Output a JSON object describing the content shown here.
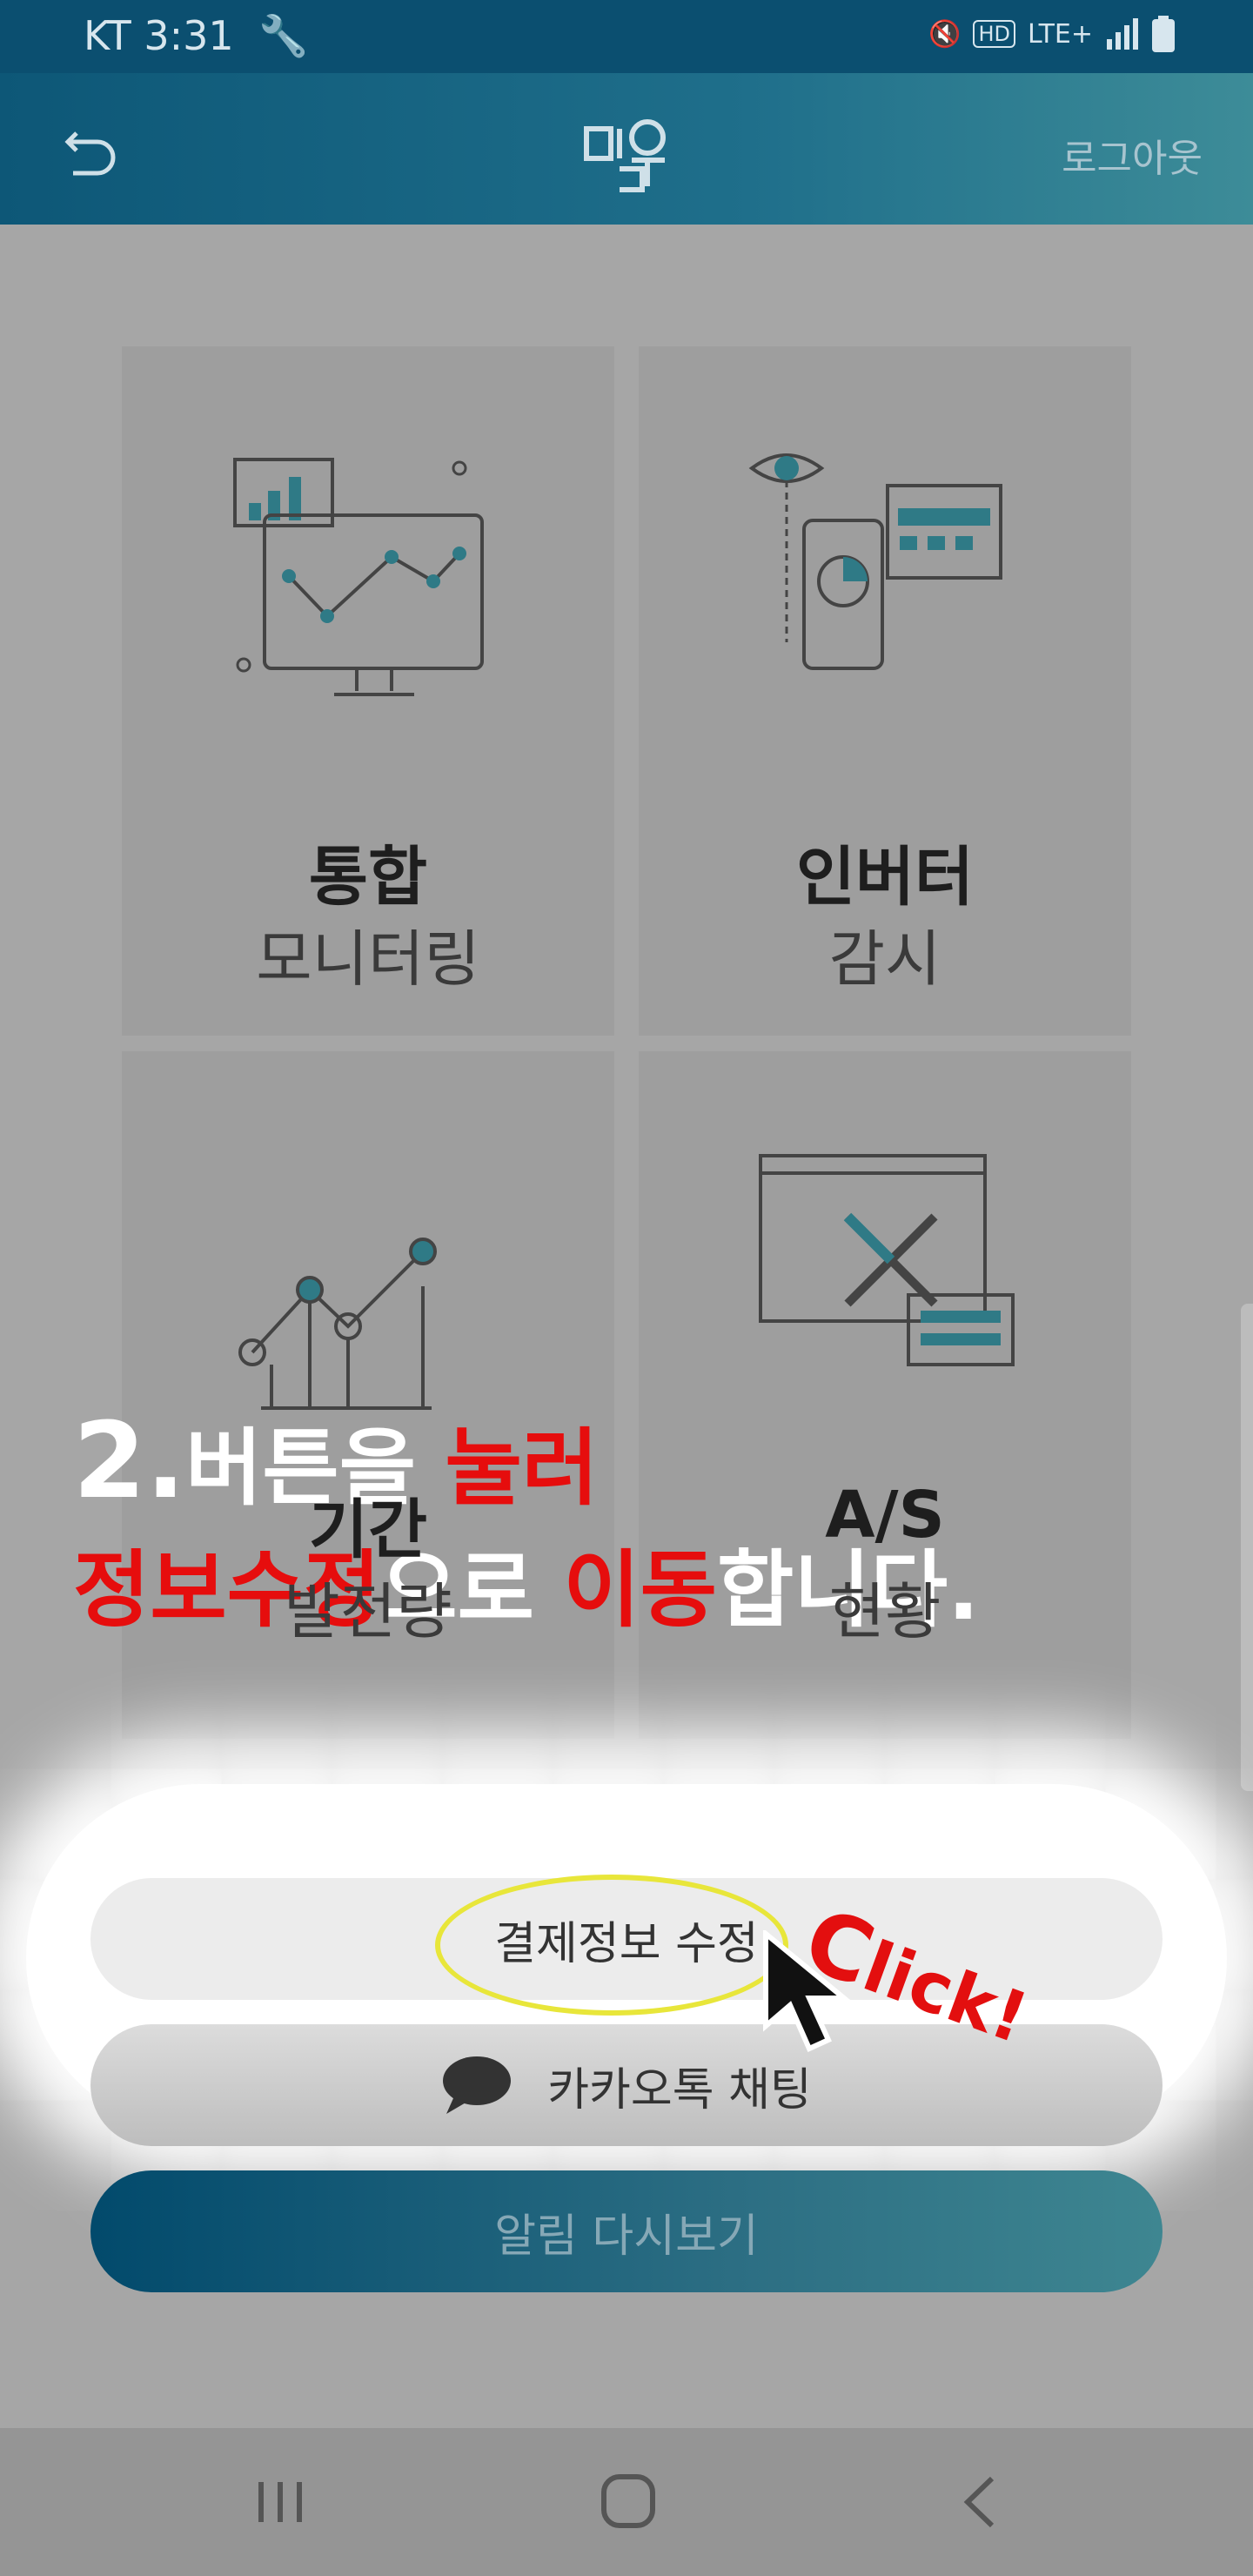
{
  "status": {
    "carrier_time": "KT 3:31",
    "network": "LTE+",
    "hd": "HD"
  },
  "appbar": {
    "logout_label": "로그아웃"
  },
  "tiles": [
    {
      "bold": "통합",
      "sub": "모니터링",
      "icon": "monitor-chart-icon"
    },
    {
      "bold": "인버터",
      "sub": "감시",
      "icon": "eye-devices-icon"
    },
    {
      "bold": "기간",
      "sub": "발전량",
      "icon": "line-graph-icon"
    },
    {
      "bold": "A/S",
      "sub": "현황",
      "icon": "tools-window-icon"
    }
  ],
  "caption": {
    "num": "2.",
    "line1_a": "버튼을 ",
    "line1_b": "눌러",
    "line2_a": "정보수정",
    "line2_b": "으로 ",
    "line2_c": "이동",
    "line2_d": "합니다."
  },
  "buttons": {
    "payment_edit": "결제정보 수정",
    "kakao_chat": "카카오톡 채팅",
    "notifications_replay": "알림 다시보기"
  },
  "annotation": {
    "click_c": "C",
    "click_rest": "lick!"
  },
  "colors": {
    "accent": "#0b4f70",
    "highlight": "#e60d0d",
    "ellipse": "#e8e63a"
  }
}
